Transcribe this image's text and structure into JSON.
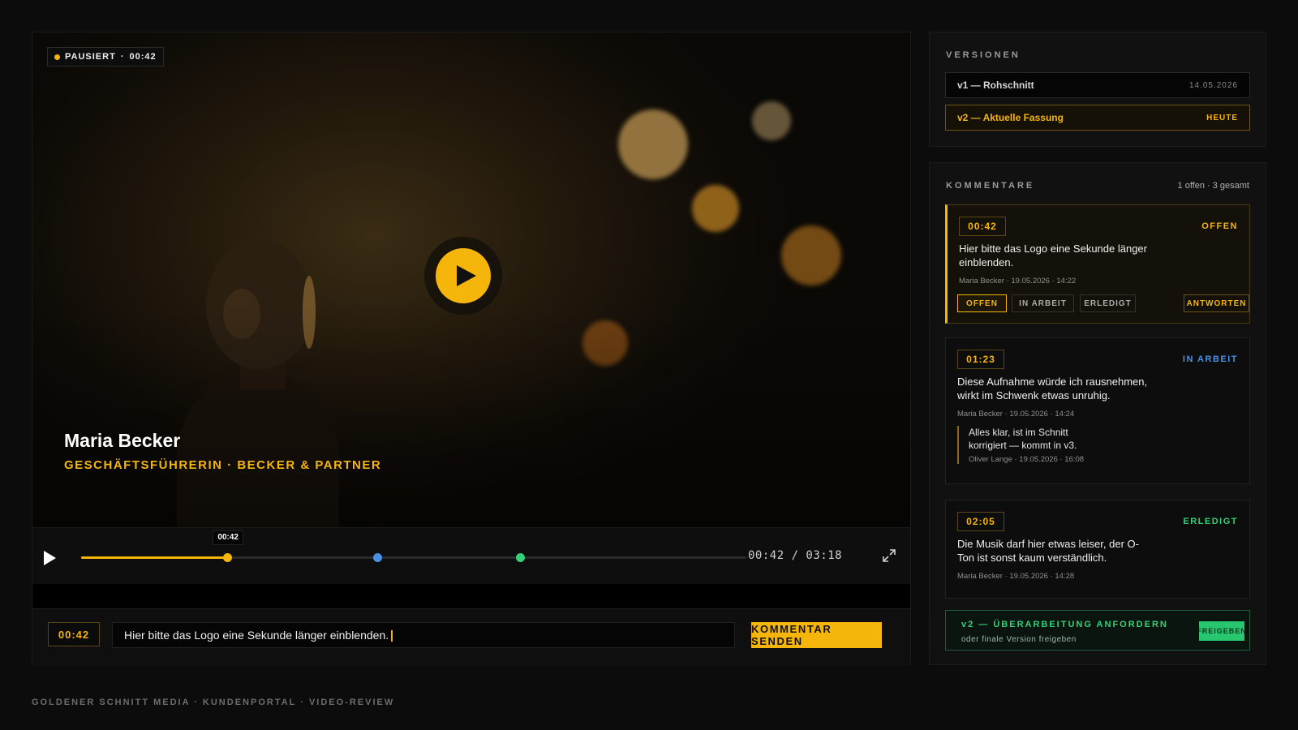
{
  "player": {
    "status": "PAUSIERT",
    "status_time": "00:42",
    "lower_third": {
      "name": "Maria Becker",
      "role": "GESCHÄFTSFÜHRERIN · BECKER & PARTNER"
    },
    "tooltip": "00:42",
    "time_readout": "00:42 / 03:18",
    "progress": 0.22,
    "markers": [
      {
        "position": 0.22,
        "color": "#f5b50a"
      },
      {
        "position": 0.445,
        "color": "#4a90e2"
      },
      {
        "position": 0.66,
        "color": "#34d07a"
      }
    ]
  },
  "composer": {
    "timestamp": "00:42",
    "value": "Hier bitte das Logo eine Sekunde länger einblenden.",
    "send_label": "KOMMENTAR SENDEN"
  },
  "footer": "GOLDENER SCHNITT MEDIA · KUNDENPORTAL · VIDEO-REVIEW",
  "versions": {
    "title": "VERSIONEN",
    "items": [
      {
        "label": "v1 — Rohschnitt",
        "meta": "14.05.2026"
      },
      {
        "label": "v2 — Aktuelle Fassung",
        "meta": "HEUTE"
      }
    ]
  },
  "comments": {
    "title": "KOMMENTARE",
    "count": "1 offen · 3 gesamt",
    "items": [
      {
        "timecode": "00:42",
        "state": "OFFEN",
        "text": "Hier bitte das Logo eine Sekunde länger einblenden.",
        "by": "Maria Becker · 19.05.2026 · 14:22",
        "actions": [
          "OFFEN",
          "IN ARBEIT",
          "ERLEDIGT",
          "ANTWORTEN"
        ]
      },
      {
        "timecode": "01:23",
        "state": "IN ARBEIT",
        "text": "Diese Aufnahme würde ich rausnehmen, wirkt im Schwenk etwas unruhig.",
        "by": "Maria Becker · 19.05.2026 · 14:24",
        "reply": {
          "text": "Alles klar, ist im Schnitt korrigiert — kommt in v3.",
          "by": "Oliver Lange · 19.05.2026 · 16:08"
        }
      },
      {
        "timecode": "02:05",
        "state": "ERLEDIGT",
        "text": "Die Musik darf hier etwas leiser, der O-Ton ist sonst kaum verständlich.",
        "by": "Maria Becker · 19.05.2026 · 14:28"
      }
    ]
  },
  "revision": {
    "title": "v2 — ÜBERARBEITUNG ANFORDERN",
    "subtitle": "oder finale Version freigeben",
    "approve_label": "FREIGEBEN"
  },
  "colors": {
    "accent": "#f5b50a",
    "in_progress": "#4a90e2",
    "done": "#34d07a"
  }
}
